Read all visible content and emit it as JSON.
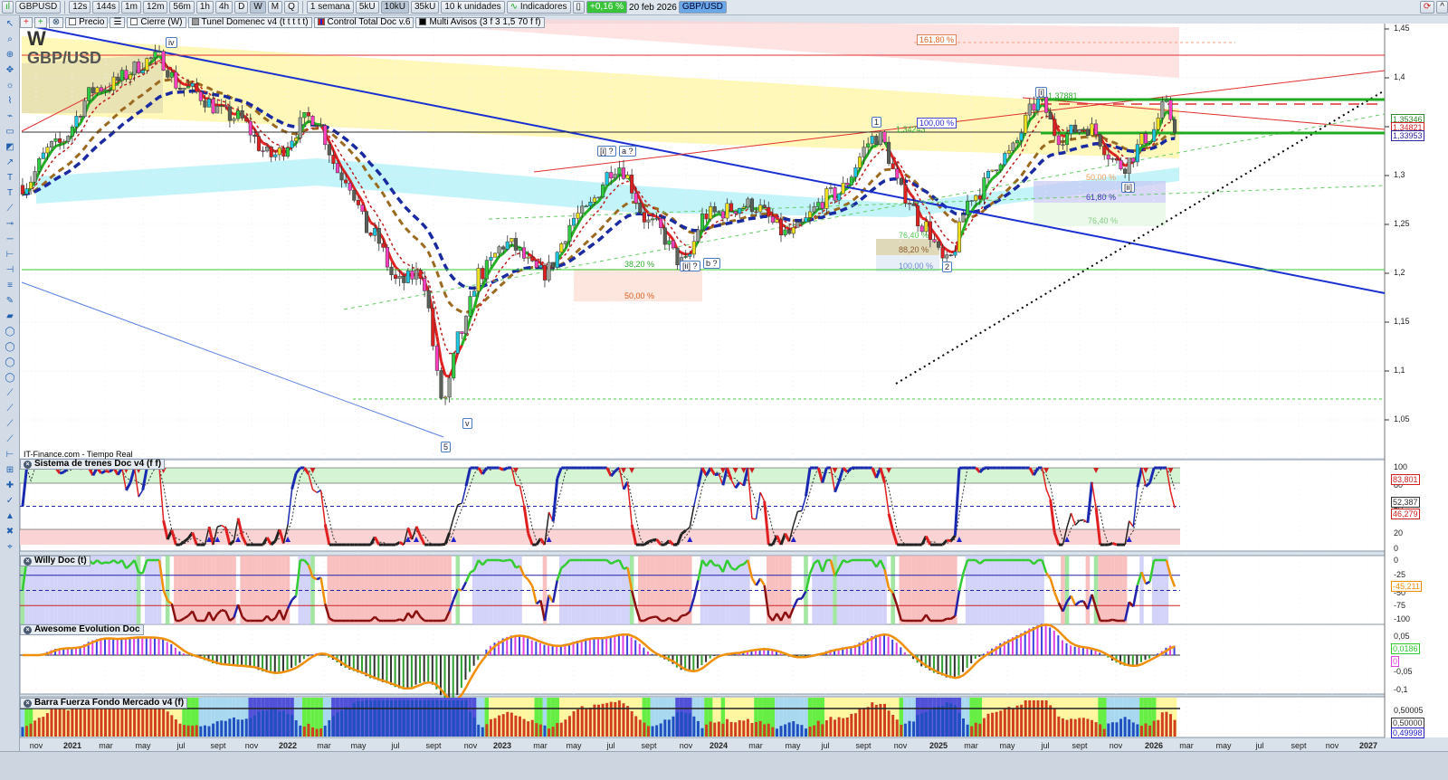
{
  "toolbar": {
    "symbol": "GBPUSD",
    "intervals": [
      "12s",
      "144s",
      "1m",
      "12m",
      "56m",
      "1h",
      "4h",
      "D",
      "W",
      "M",
      "Q"
    ],
    "selected_interval": "W",
    "period": "1 semana",
    "units": [
      "5kU",
      "10kU",
      "35kU"
    ],
    "selected_unit": "10kU",
    "unit_select": "10 k unidades",
    "indicators_label": "Indicadores",
    "change": "+0,16 %",
    "date": "20 feb 2026",
    "pair_badge": "GBP/USD"
  },
  "legend": {
    "items": [
      "Precio",
      "Cierre (W)",
      "Tunel Domenec v4 (t t t t t)",
      "Control Total Doc v.6",
      "Multi Avisos (3 f 3 1,5 70 f f)"
    ]
  },
  "main": {
    "period_letter": "W",
    "instrument": "GBP/USD",
    "source": "IT-Finance.com - Tiempo Real",
    "y_ticks": [
      "1,45",
      "1,4",
      "1,35",
      "1,3",
      "1,25",
      "1,2",
      "1,15",
      "1,1",
      "1,05"
    ],
    "price_labels": [
      {
        "value": "1,35346",
        "color": "#2e8b2e"
      },
      {
        "value": "1,34821",
        "color": "#d02020"
      },
      {
        "value": "1,33953",
        "color": "#2a2aa0"
      }
    ],
    "annotations": {
      "iv": "iv",
      "i_q": "[i] ?",
      "a_q": "a ?",
      "one": "1",
      "i": "[i]",
      "ii": "[ii]",
      "two": "2",
      "b_q": "b ?",
      "ii_q": "[ii] ?",
      "v": "v",
      "five": "5",
      "high1": "1,34243",
      "high2": "1,37881"
    },
    "fib_labels": {
      "f1618": "161,80 %",
      "f100a": "100,00 %",
      "f382": "38,20 %",
      "f50a": "50,00 %",
      "f764a": "76,40 %",
      "f882": "88,20 %",
      "f100b": "100,00 %",
      "f50b": "50,00 %",
      "f618": "61,80 %",
      "f764b": "76,40 %"
    }
  },
  "panes": {
    "sistema": {
      "title": "Sistema de trenes Doc v4 (f f)",
      "ticks": [
        "100",
        "80",
        "50",
        "20",
        "0"
      ],
      "labels": [
        "83,801",
        "52,387",
        "46,279"
      ]
    },
    "willy": {
      "title": "Willy Doc (t)",
      "ticks": [
        "0",
        "-25",
        "-50",
        "-75",
        "-100"
      ],
      "labels": [
        "-45,211"
      ]
    },
    "awesome": {
      "title": "Awesome Evolution Doc",
      "ticks": [
        "0,05",
        "-0,05",
        "-0,1"
      ],
      "labels": [
        "0,0186",
        "0"
      ]
    },
    "barra": {
      "title": "Barra Fuerza Fondo Mercado v4 (f)",
      "ticks": [
        "0,50005"
      ],
      "labels": [
        "0,50000",
        "0,49998"
      ]
    }
  },
  "x_axis": [
    "nov",
    "2021",
    "mar",
    "may",
    "jul",
    "sept",
    "nov",
    "2022",
    "mar",
    "may",
    "jul",
    "sept",
    "nov",
    "2023",
    "mar",
    "may",
    "jul",
    "sept",
    "nov",
    "2024",
    "mar",
    "may",
    "jul",
    "sept",
    "nov",
    "2025",
    "mar",
    "may",
    "jul",
    "sept",
    "nov",
    "2026",
    "mar",
    "may",
    "jul",
    "sept",
    "nov",
    "2027"
  ],
  "chart_data": {
    "type": "candlestick",
    "interval": "weekly",
    "x_unit": "months since nov 2020",
    "ylim": [
      1.03,
      1.46
    ],
    "keypoints": [
      [
        -0.76,
        1.29
      ],
      [
        1.0,
        1.33
      ],
      [
        3.5,
        1.39
      ],
      [
        6.8,
        1.42
      ],
      [
        8.1,
        1.39
      ],
      [
        11.1,
        1.36
      ],
      [
        13.1,
        1.32
      ],
      [
        15.4,
        1.36
      ],
      [
        17.1,
        1.3
      ],
      [
        18.7,
        1.24
      ],
      [
        20.2,
        1.19
      ],
      [
        21.4,
        1.2
      ],
      [
        22.7,
        1.07
      ],
      [
        23.7,
        1.14
      ],
      [
        24.7,
        1.2
      ],
      [
        26.2,
        1.23
      ],
      [
        28.2,
        1.2
      ],
      [
        30.3,
        1.26
      ],
      [
        32.4,
        1.31
      ],
      [
        34.3,
        1.25
      ],
      [
        36.1,
        1.21
      ],
      [
        37.3,
        1.26
      ],
      [
        39.8,
        1.27
      ],
      [
        41.9,
        1.24
      ],
      [
        44.4,
        1.28
      ],
      [
        46.9,
        1.34
      ],
      [
        48.4,
        1.28
      ],
      [
        49.4,
        1.25
      ],
      [
        50.7,
        1.21
      ],
      [
        52.2,
        1.28
      ],
      [
        54.0,
        1.32
      ],
      [
        55.9,
        1.375
      ],
      [
        57.0,
        1.34
      ],
      [
        58.5,
        1.35
      ],
      [
        60.5,
        1.31
      ],
      [
        62.0,
        1.34
      ],
      [
        62.9,
        1.37
      ],
      [
        63.5,
        1.35
      ]
    ],
    "colors": {
      "up": [
        "#2ecc40",
        "#1ec8e0",
        "#f0e020",
        "#9aa29a"
      ],
      "down": [
        "#e02020",
        "#ff40c0",
        "#5a6058"
      ]
    }
  }
}
